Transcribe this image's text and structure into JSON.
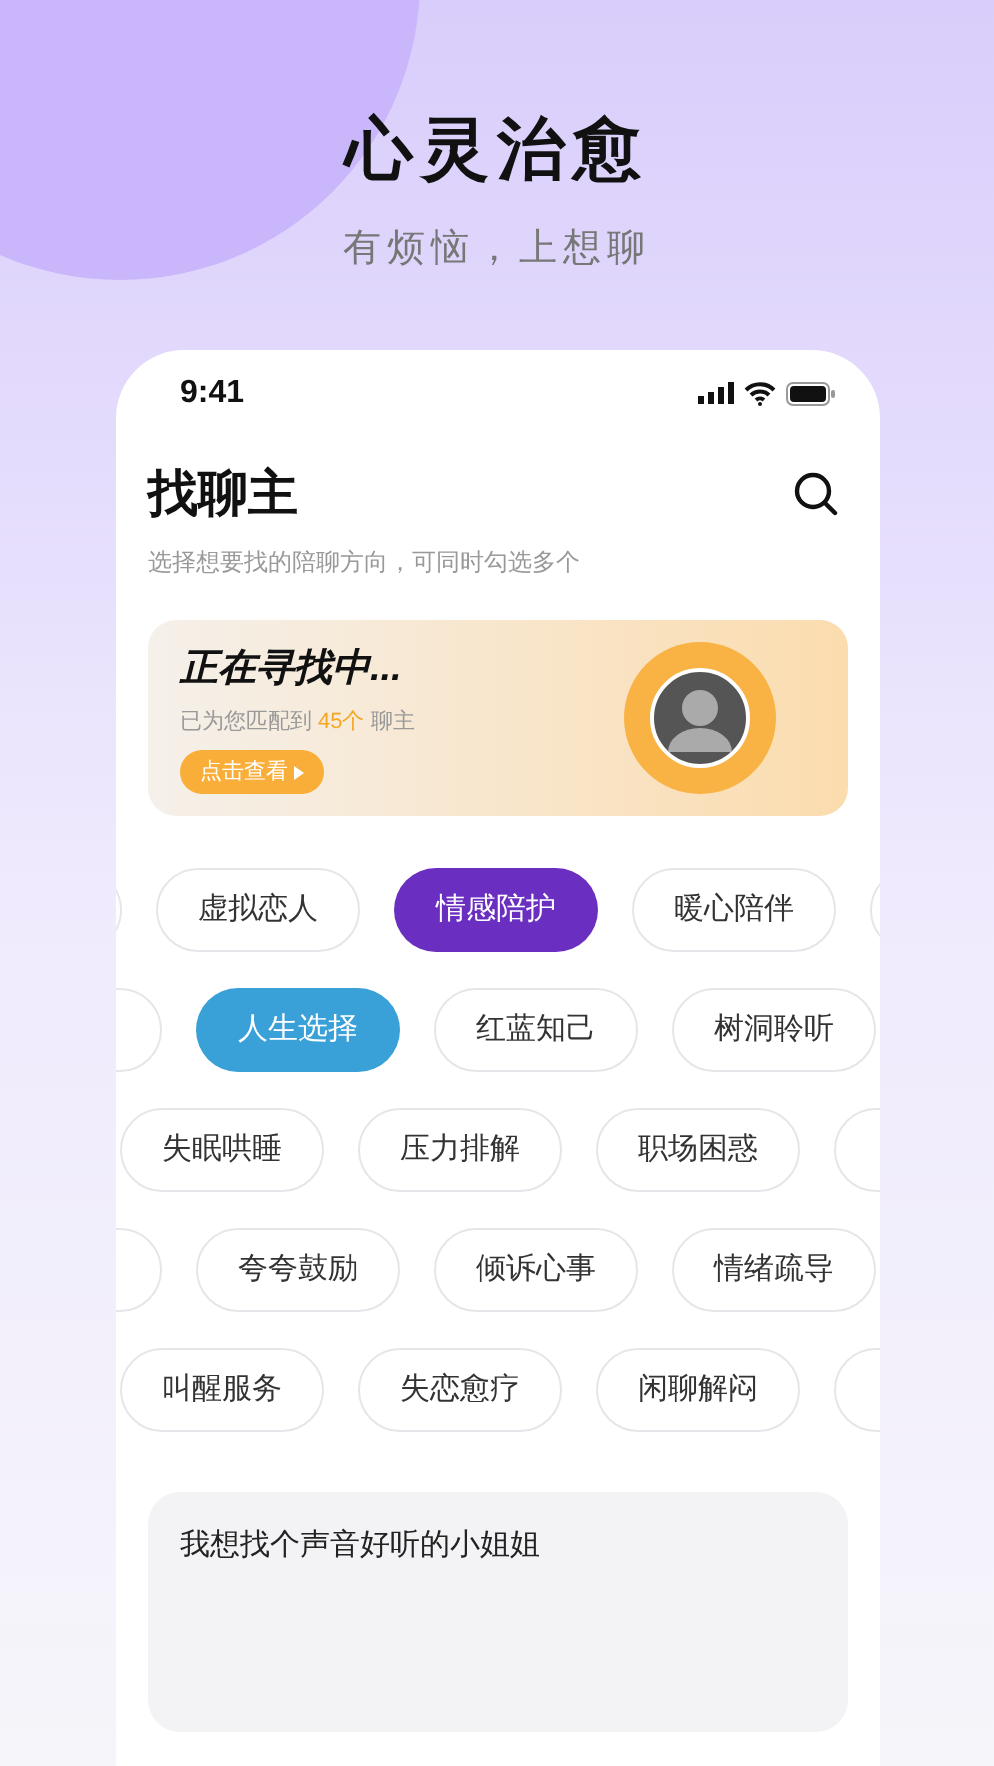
{
  "headline": {
    "title": "心灵治愈",
    "subtitle": "有烦恼，上想聊"
  },
  "status_bar": {
    "time": "9:41"
  },
  "header": {
    "title": "找聊主",
    "subtitle": "选择想要找的陪聊方向，可同时勾选多个"
  },
  "match_card": {
    "title": "正在寻找中...",
    "text_before": "已为您匹配到",
    "count": "45个",
    "text_after": "聊主",
    "button": "点击查看"
  },
  "tag_rows": [
    {
      "leading_partial": true,
      "tags": [
        {
          "label": "虚拟恋人",
          "selected": false
        },
        {
          "label": "情感陪护",
          "selected": true,
          "color": "#6a2fc0"
        },
        {
          "label": "暖心陪伴",
          "selected": false
        }
      ]
    },
    {
      "leading_partial": true,
      "tags": [
        {
          "label": "人生选择",
          "selected": true,
          "color": "#3aa0d8"
        },
        {
          "label": "红蓝知己",
          "selected": false
        },
        {
          "label": "树洞聆听",
          "selected": false
        }
      ]
    },
    {
      "leading_partial": false,
      "tags": [
        {
          "label": "失眠哄睡",
          "selected": false
        },
        {
          "label": "压力排解",
          "selected": false
        },
        {
          "label": "职场困惑",
          "selected": false
        }
      ]
    },
    {
      "leading_partial": true,
      "tags": [
        {
          "label": "夸夸鼓励",
          "selected": false
        },
        {
          "label": "倾诉心事",
          "selected": false
        },
        {
          "label": "情绪疏导",
          "selected": false
        }
      ]
    },
    {
      "leading_partial": false,
      "tags": [
        {
          "label": "叫醒服务",
          "selected": false
        },
        {
          "label": "失恋愈疗",
          "selected": false
        },
        {
          "label": "闲聊解闷",
          "selected": false
        }
      ]
    }
  ],
  "request_field": {
    "value": "我想找个声音好听的小姐姐"
  }
}
